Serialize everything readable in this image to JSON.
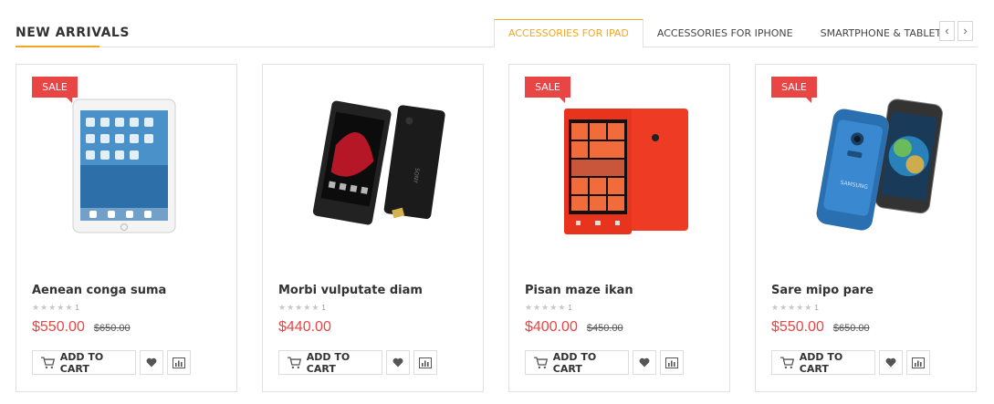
{
  "section": {
    "title": "NEW ARRIVALS"
  },
  "tabs": [
    {
      "label": "ACCESSORIES FOR IPAD",
      "active": true
    },
    {
      "label": "ACCESSORIES FOR IPHONE",
      "active": false
    },
    {
      "label": "SMARTPHONE & TABLETS",
      "active": false
    }
  ],
  "nav": {
    "prev": "‹",
    "next": "›"
  },
  "colors": {
    "accent": "#f5a623",
    "sale": "#e94545",
    "price": "#e94545",
    "border": "#e1e1e1"
  },
  "products": [
    {
      "name": "Aenean conga suma",
      "sale_label": "SALE",
      "rating_count": "1",
      "price": "$550.00",
      "old_price": "$650.00",
      "add_to_cart": "ADD TO CART",
      "image": "ipad-white"
    },
    {
      "name": "Morbi vulputate diam",
      "sale_label": "",
      "rating_count": "1",
      "price": "$440.00",
      "old_price": "",
      "add_to_cart": "ADD TO CART",
      "image": "sony-xperia-black"
    },
    {
      "name": "Pisan maze ikan",
      "sale_label": "SALE",
      "rating_count": "1",
      "price": "$400.00",
      "old_price": "$450.00",
      "add_to_cart": "ADD TO CART",
      "image": "nokia-lumia-red"
    },
    {
      "name": "Sare mipo pare",
      "sale_label": "SALE",
      "rating_count": "1",
      "price": "$550.00",
      "old_price": "$650.00",
      "add_to_cart": "ADD TO CART",
      "image": "samsung-galaxy-blue"
    }
  ]
}
